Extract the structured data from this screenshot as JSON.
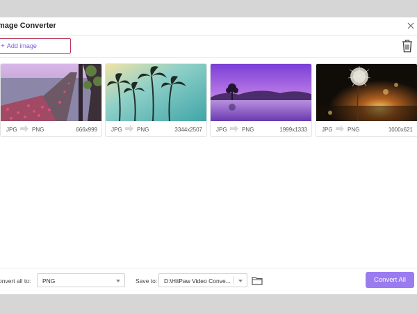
{
  "window": {
    "title": "mage Converter"
  },
  "toolbar": {
    "add_label": "Add image",
    "add_icon": "plus-icon",
    "delete_icon": "trash-icon"
  },
  "images": [
    {
      "from": "JPG",
      "to": "PNG",
      "dims": "666x999"
    },
    {
      "from": "JPG",
      "to": "PNG",
      "dims": "3344x2507"
    },
    {
      "from": "JPG",
      "to": "PNG",
      "dims": "1999x1333"
    },
    {
      "from": "JPG",
      "to": "PNG",
      "dims": "1000x621"
    }
  ],
  "footer": {
    "convert_all_label": "onvert all to:",
    "format_value": "PNG",
    "save_to_label": "Save to:",
    "save_path": "D:\\HitPaw Video Conve...",
    "convert_button": "Convert All"
  },
  "colors": {
    "accent": "#9a7cf0",
    "add_border": "#b8395a",
    "add_text": "#7a5bd6"
  }
}
